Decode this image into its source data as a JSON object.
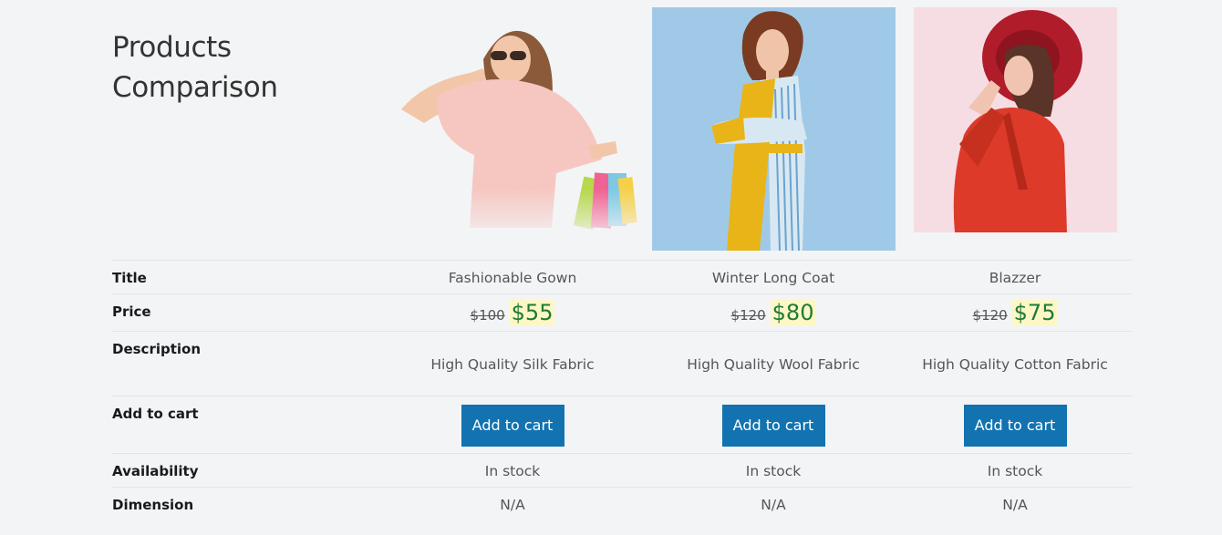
{
  "heading": "Products Comparison",
  "heading_line1": "Products",
  "heading_line2": "Comparison",
  "labels": {
    "title": "Title",
    "price": "Price",
    "description": "Description",
    "add_to_cart": "Add to cart",
    "availability": "Availability",
    "dimension": "Dimension"
  },
  "products": [
    {
      "title": "Fashionable Gown",
      "old_price": "$100",
      "new_price": "$55",
      "description": "High Quality Silk Fabric",
      "button": "Add to cart",
      "availability": "In stock",
      "dimension": "N/A"
    },
    {
      "title": "Winter Long Coat",
      "old_price": "$120",
      "new_price": "$80",
      "description": "High Quality Wool Fabric",
      "button": "Add to cart",
      "availability": "In stock",
      "dimension": "N/A"
    },
    {
      "title": "Blazzer",
      "old_price": "$120",
      "new_price": "$75",
      "description": "High Quality Cotton Fabric",
      "button": "Add to cart",
      "availability": "In stock",
      "dimension": "N/A"
    }
  ],
  "colors": {
    "background": "#f3f4f6",
    "button": "#1273b0",
    "sale_price": "#1f7a3a",
    "sale_highlight": "#fdf7c4"
  }
}
